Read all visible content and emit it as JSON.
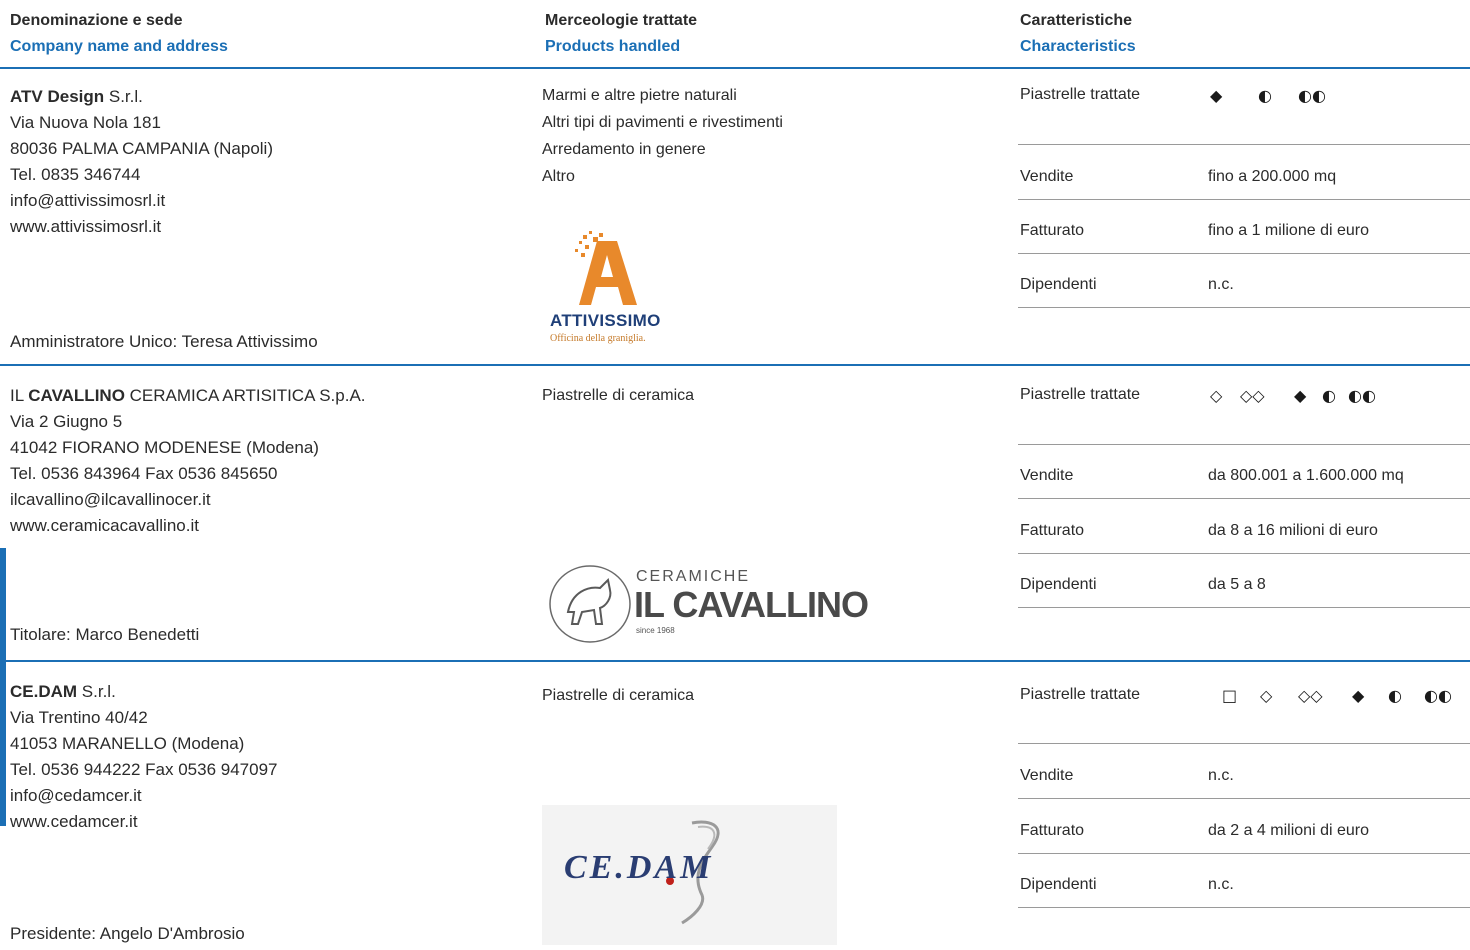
{
  "headers": {
    "col1_it": "Denominazione e sede",
    "col1_en": "Company name and address",
    "col2_it": "Merceologie trattate",
    "col2_en": "Products handled",
    "col3_it": "Caratteristiche",
    "col3_en": "Characteristics"
  },
  "companies": [
    {
      "name_bold": "ATV Design",
      "name_rest": " S.r.l.",
      "address": "Via Nuova Nola 181",
      "city": "80036 PALMA CAMPANIA (Napoli)",
      "phone": "Tel. 0835 346744",
      "email": "info@attivissimosrl.it",
      "web": "www.attivissimosrl.it",
      "signatory": "Amministratore Unico: Teresa Attivissimo",
      "products": [
        "Marmi e altre pietre naturali",
        "Altri tipi di pavimenti e rivestimenti",
        "Arredamento in genere",
        "Altro"
      ],
      "logo_text": "ATTIVISSIMO",
      "logo_sub": "Officina della graniglia.",
      "tiles_label": "Piastrelle trattate",
      "tiles_symbols": [
        "◆",
        "◐",
        "◐◐"
      ],
      "sales_label": "Vendite",
      "sales": "fino a 200.000 mq",
      "turnover_label": "Fatturato",
      "turnover": "fino a 1 milione di euro",
      "employees_label": "Dipendenti",
      "employees": "n.c."
    },
    {
      "name_pre": "IL ",
      "name_bold": "CAVALLINO",
      "name_rest": " CERAMICA ARTISITICA S.p.A.",
      "address": "Via 2 Giugno 5",
      "city": "41042 FIORANO MODENESE (Modena)",
      "phone": "Tel. 0536 843964  Fax 0536 845650",
      "email": "ilcavallino@ilcavallinocer.it",
      "web": "www.ceramicacavallino.it",
      "signatory": "Titolare: Marco Benedetti",
      "products": [
        "Piastrelle di ceramica"
      ],
      "logo_top": "CERAMICHE",
      "logo_main": "IL CAVALLINO",
      "logo_since": "since 1968",
      "tiles_label": "Piastrelle trattate",
      "tiles_symbols": [
        "◇",
        "◇◇",
        "◆",
        "◐",
        "◐◐"
      ],
      "sales_label": "Vendite",
      "sales": "da 800.001 a 1.600.000 mq",
      "turnover_label": "Fatturato",
      "turnover": "da 8 a 16 milioni di euro",
      "employees_label": "Dipendenti",
      "employees": "da 5 a 8"
    },
    {
      "name_bold": "CE.DAM",
      "name_rest": " S.r.l.",
      "address": "Via Trentino 40/42",
      "city": "41053  MARANELLO  (Modena)",
      "phone": "Tel. 0536 944222   Fax 0536 947097",
      "email": "info@cedamcer.it",
      "web": "www.cedamcer.it",
      "signatory": "Presidente: Angelo D'Ambrosio",
      "products": [
        "Piastrelle di ceramica"
      ],
      "logo_text": "CE.DAM",
      "tiles_label": "Piastrelle trattate",
      "tiles_symbols": [
        "□",
        "◇",
        "◇◇",
        "◆",
        "◐",
        "◐◐"
      ],
      "sales_label": "Vendite",
      "sales": "n.c.",
      "turnover_label": "Fatturato",
      "turnover": "da 2 a 4 milioni di euro",
      "employees_label": "Dipendenti",
      "employees": "n.c."
    }
  ],
  "colors": {
    "accent": "#1b6fb5",
    "logo_orange": "#e8892b",
    "logo_navy": "#1f3f78"
  }
}
